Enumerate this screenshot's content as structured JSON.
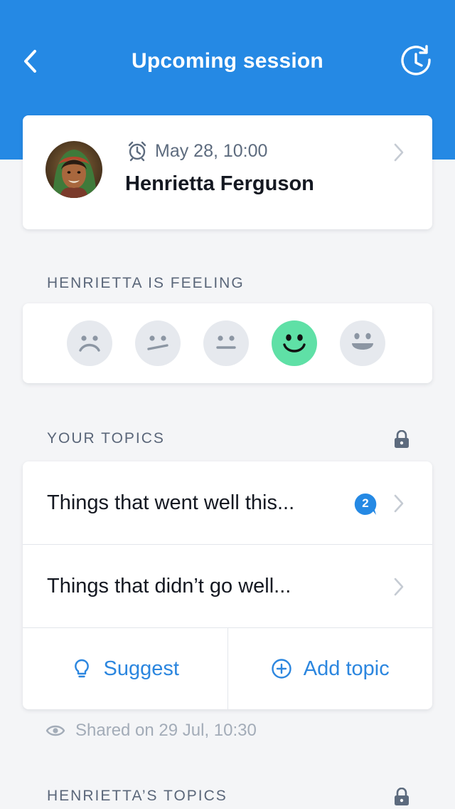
{
  "header": {
    "title": "Upcoming session",
    "back_icon": "chevron-left-icon",
    "history_icon": "clock-history-icon",
    "background_color": "#2589e4"
  },
  "session": {
    "time": "May 28, 10:00",
    "name": "Henrietta Ferguson",
    "time_icon": "alarm-clock-icon"
  },
  "feeling": {
    "label": "HENRIETTA IS FEELING",
    "moods": [
      "very-sad",
      "unsure",
      "neutral",
      "happy",
      "very-happy"
    ],
    "selected": "happy",
    "selected_color": "#5fe0a6"
  },
  "your_topics": {
    "label": "YOUR TOPICS",
    "items": [
      {
        "label": "Things that went well this...",
        "comment_count": "2"
      },
      {
        "label": "Things that didn’t go well..."
      }
    ],
    "suggest_label": "Suggest",
    "add_topic_label": "Add topic",
    "accent_color": "#2b86df"
  },
  "shared": {
    "text": "Shared on 29 Jul, 10:30"
  },
  "henrietta_topics": {
    "label": "HENRIETTA’S TOPICS"
  }
}
